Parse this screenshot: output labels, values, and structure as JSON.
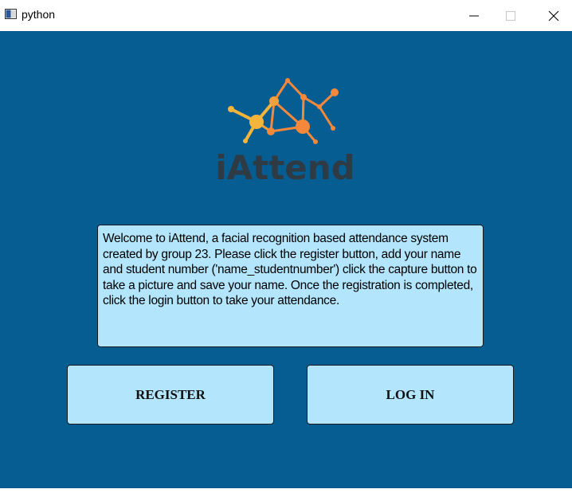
{
  "window": {
    "title": "python",
    "controls": {
      "minimize_icon": "minimize-icon",
      "maximize_icon": "maximize-icon",
      "close_icon": "close-icon"
    }
  },
  "logo": {
    "text": "iAttend",
    "colors": {
      "orange": "#f5883a",
      "yellow": "#f5b53b",
      "text": "#2e3b44"
    }
  },
  "welcome": {
    "text": "Welcome to iAttend, a facial recognition based attendance system created by group 23. Please click the register button, add your name and student number ('name_studentnumber') click the capture button to take a picture and save your name. Once the registration is completed, click the login button to take your attendance."
  },
  "buttons": {
    "register_label": "REGISTER",
    "login_label": "LOG IN"
  },
  "colors": {
    "background": "#065d91",
    "panel": "#b3e5fc"
  }
}
